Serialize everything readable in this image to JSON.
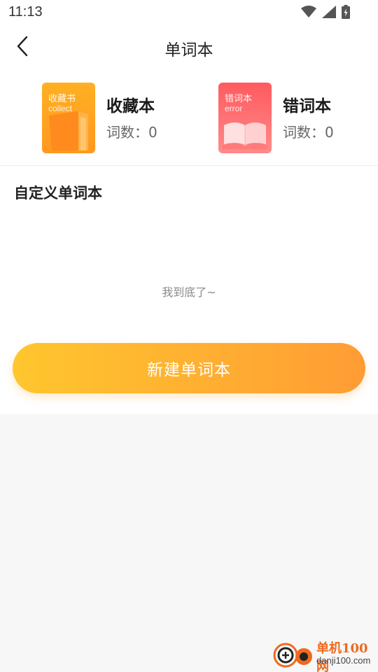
{
  "status_bar": {
    "time": "11:13",
    "icons": [
      "wifi-icon",
      "signal-icon",
      "battery-icon"
    ]
  },
  "nav": {
    "title": "单词本",
    "back_icon": "chevron-left-icon"
  },
  "books": [
    {
      "cover_title": "收藏书",
      "cover_subtitle": "collect",
      "name": "收藏本",
      "count_label": "词数：0",
      "color": "#ffa421"
    },
    {
      "cover_title": "错词本",
      "cover_subtitle": "error",
      "name": "错词本",
      "count_label": "词数：0",
      "color": "#ff6166"
    }
  ],
  "custom_section": {
    "title": "自定义单词本",
    "end_text": "我到底了~"
  },
  "actions": {
    "new_button": "新建单词本"
  },
  "watermark": {
    "line1": "单机100网",
    "line2": "danji100.com"
  },
  "colors": {
    "accent_start": "#ffc62e",
    "accent_end": "#ff9c34",
    "background": "#f7f7f7"
  }
}
